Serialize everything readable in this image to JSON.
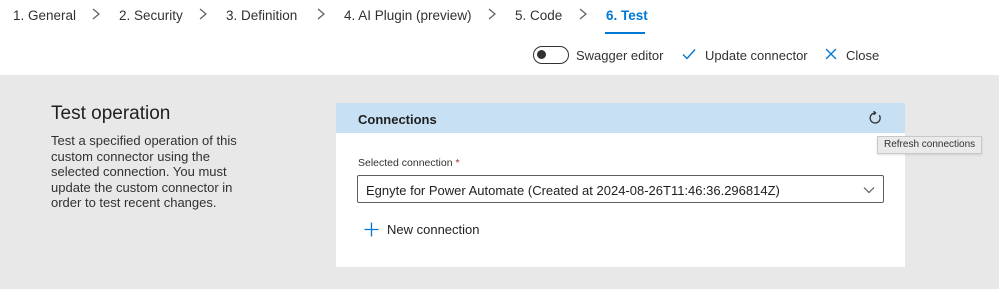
{
  "steps": [
    {
      "label": "1. General"
    },
    {
      "label": "2. Security"
    },
    {
      "label": "3. Definition"
    },
    {
      "label": "4. AI Plugin (preview)"
    },
    {
      "label": "5. Code"
    },
    {
      "label": "6. Test"
    }
  ],
  "active_step": "6. Test",
  "toolbar": {
    "swagger_label": "Swagger editor",
    "swagger_enabled": false,
    "update_label": "Update connector",
    "close_label": "Close"
  },
  "operation": {
    "title": "Test operation",
    "description": "Test a specified operation of this custom connector using the selected connection. You must update the custom connector in order to test recent changes."
  },
  "connections": {
    "title": "Connections",
    "refresh_tooltip": "Refresh connections",
    "selected_label": "Selected connection",
    "required_mark": "*",
    "selected_value": "Egnyte for Power Automate (Created at 2024-08-26T11:46:36.296814Z)",
    "new_connection_label": "New connection"
  },
  "icons": {
    "step_separator": "chevron-right-icon",
    "update": "checkmark-icon",
    "close": "close-icon",
    "refresh": "refresh-icon",
    "dropdown": "chevron-down-icon",
    "add": "plus-icon"
  },
  "colors": {
    "accent": "#0078d4",
    "card_header": "#c7e0f4",
    "band_bg": "#e8e8e8",
    "required": "#a4262c"
  }
}
